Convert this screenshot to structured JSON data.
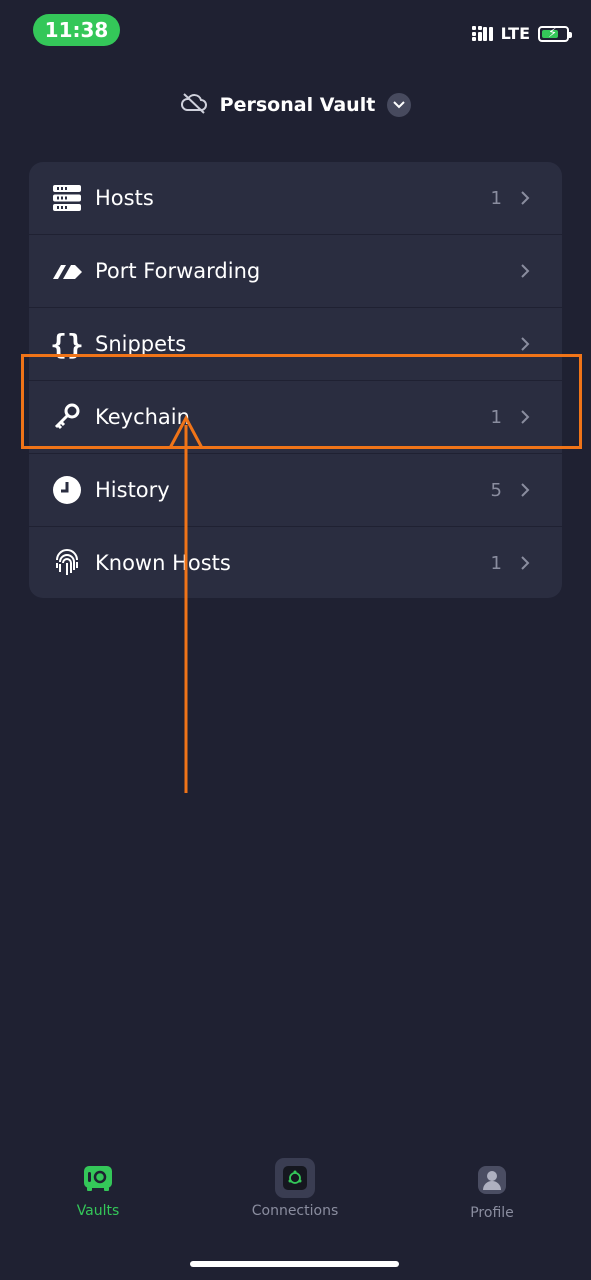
{
  "status_bar": {
    "time": "11:38",
    "network": "LTE",
    "signal_icon": "signal-icon",
    "battery_icon": "battery-charging-icon"
  },
  "header": {
    "title": "Personal Vault",
    "sync_icon": "cloud-off-icon",
    "dropdown_icon": "chevron-down-icon"
  },
  "menu": {
    "items": [
      {
        "label": "Hosts",
        "count": "1",
        "icon": "server-icon"
      },
      {
        "label": "Port Forwarding",
        "count": "",
        "icon": "port-forward-icon"
      },
      {
        "label": "Snippets",
        "count": "",
        "icon": "braces-icon"
      },
      {
        "label": "Keychain",
        "count": "1",
        "icon": "key-icon"
      },
      {
        "label": "History",
        "count": "5",
        "icon": "clock-icon"
      },
      {
        "label": "Known Hosts",
        "count": "1",
        "icon": "fingerprint-icon"
      }
    ]
  },
  "annotation": {
    "color": "#f07418",
    "highlighted_item": "Keychain"
  },
  "tabs": [
    {
      "label": "Vaults",
      "icon": "vault-icon",
      "active": true,
      "color": "#34c759"
    },
    {
      "label": "Connections",
      "icon": "connections-icon",
      "active": false,
      "color": "#8a8d9f"
    },
    {
      "label": "Profile",
      "icon": "profile-icon",
      "active": false,
      "color": "#8a8d9f"
    }
  ],
  "colors": {
    "background": "#1f2132",
    "card": "#2a2d40",
    "accent": "#34c759",
    "muted": "#8a8d9f"
  }
}
